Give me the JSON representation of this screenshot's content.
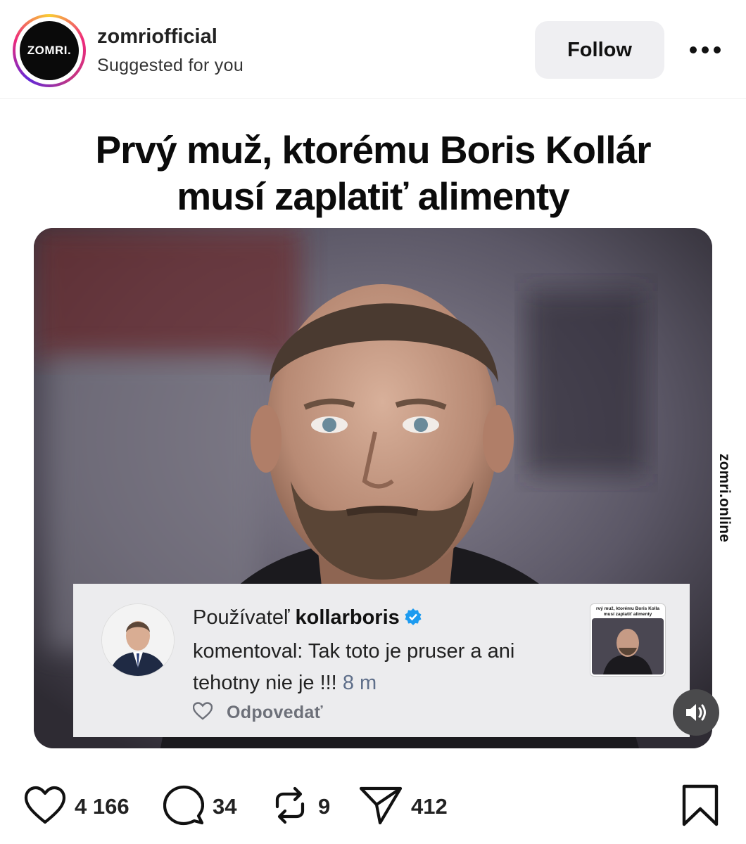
{
  "header": {
    "avatar_text": "ZOMRI.",
    "username": "zomriofficial",
    "subtitle": "Suggested for you",
    "follow_label": "Follow",
    "more_icon": "more-horizontal-icon"
  },
  "post": {
    "headline_line1": "Prvý muž, ktorému Boris Kollár",
    "headline_line2": "musí zaplatiť alimenty",
    "watermark": "zomri.online",
    "comment": {
      "prefix": "Používateľ ",
      "username": "kollarboris",
      "text_line1_suffix": "",
      "text": "komentoval: Tak toto je pruser a ani tehotny nie je !!!",
      "time": "8 m",
      "reply_label": "Odpovedať",
      "thumb_title_line1": "rvý muž, ktorému Boris Kolla",
      "thumb_title_line2": "musí zaplatiť alimenty"
    },
    "audio_icon": "speaker-icon"
  },
  "actions": {
    "likes": "4 166",
    "comments": "34",
    "reposts": "9",
    "shares": "412"
  },
  "colors": {
    "follow_bg": "#efeff2",
    "verified": "#1d9bf0",
    "card_bg": "#ececee"
  }
}
